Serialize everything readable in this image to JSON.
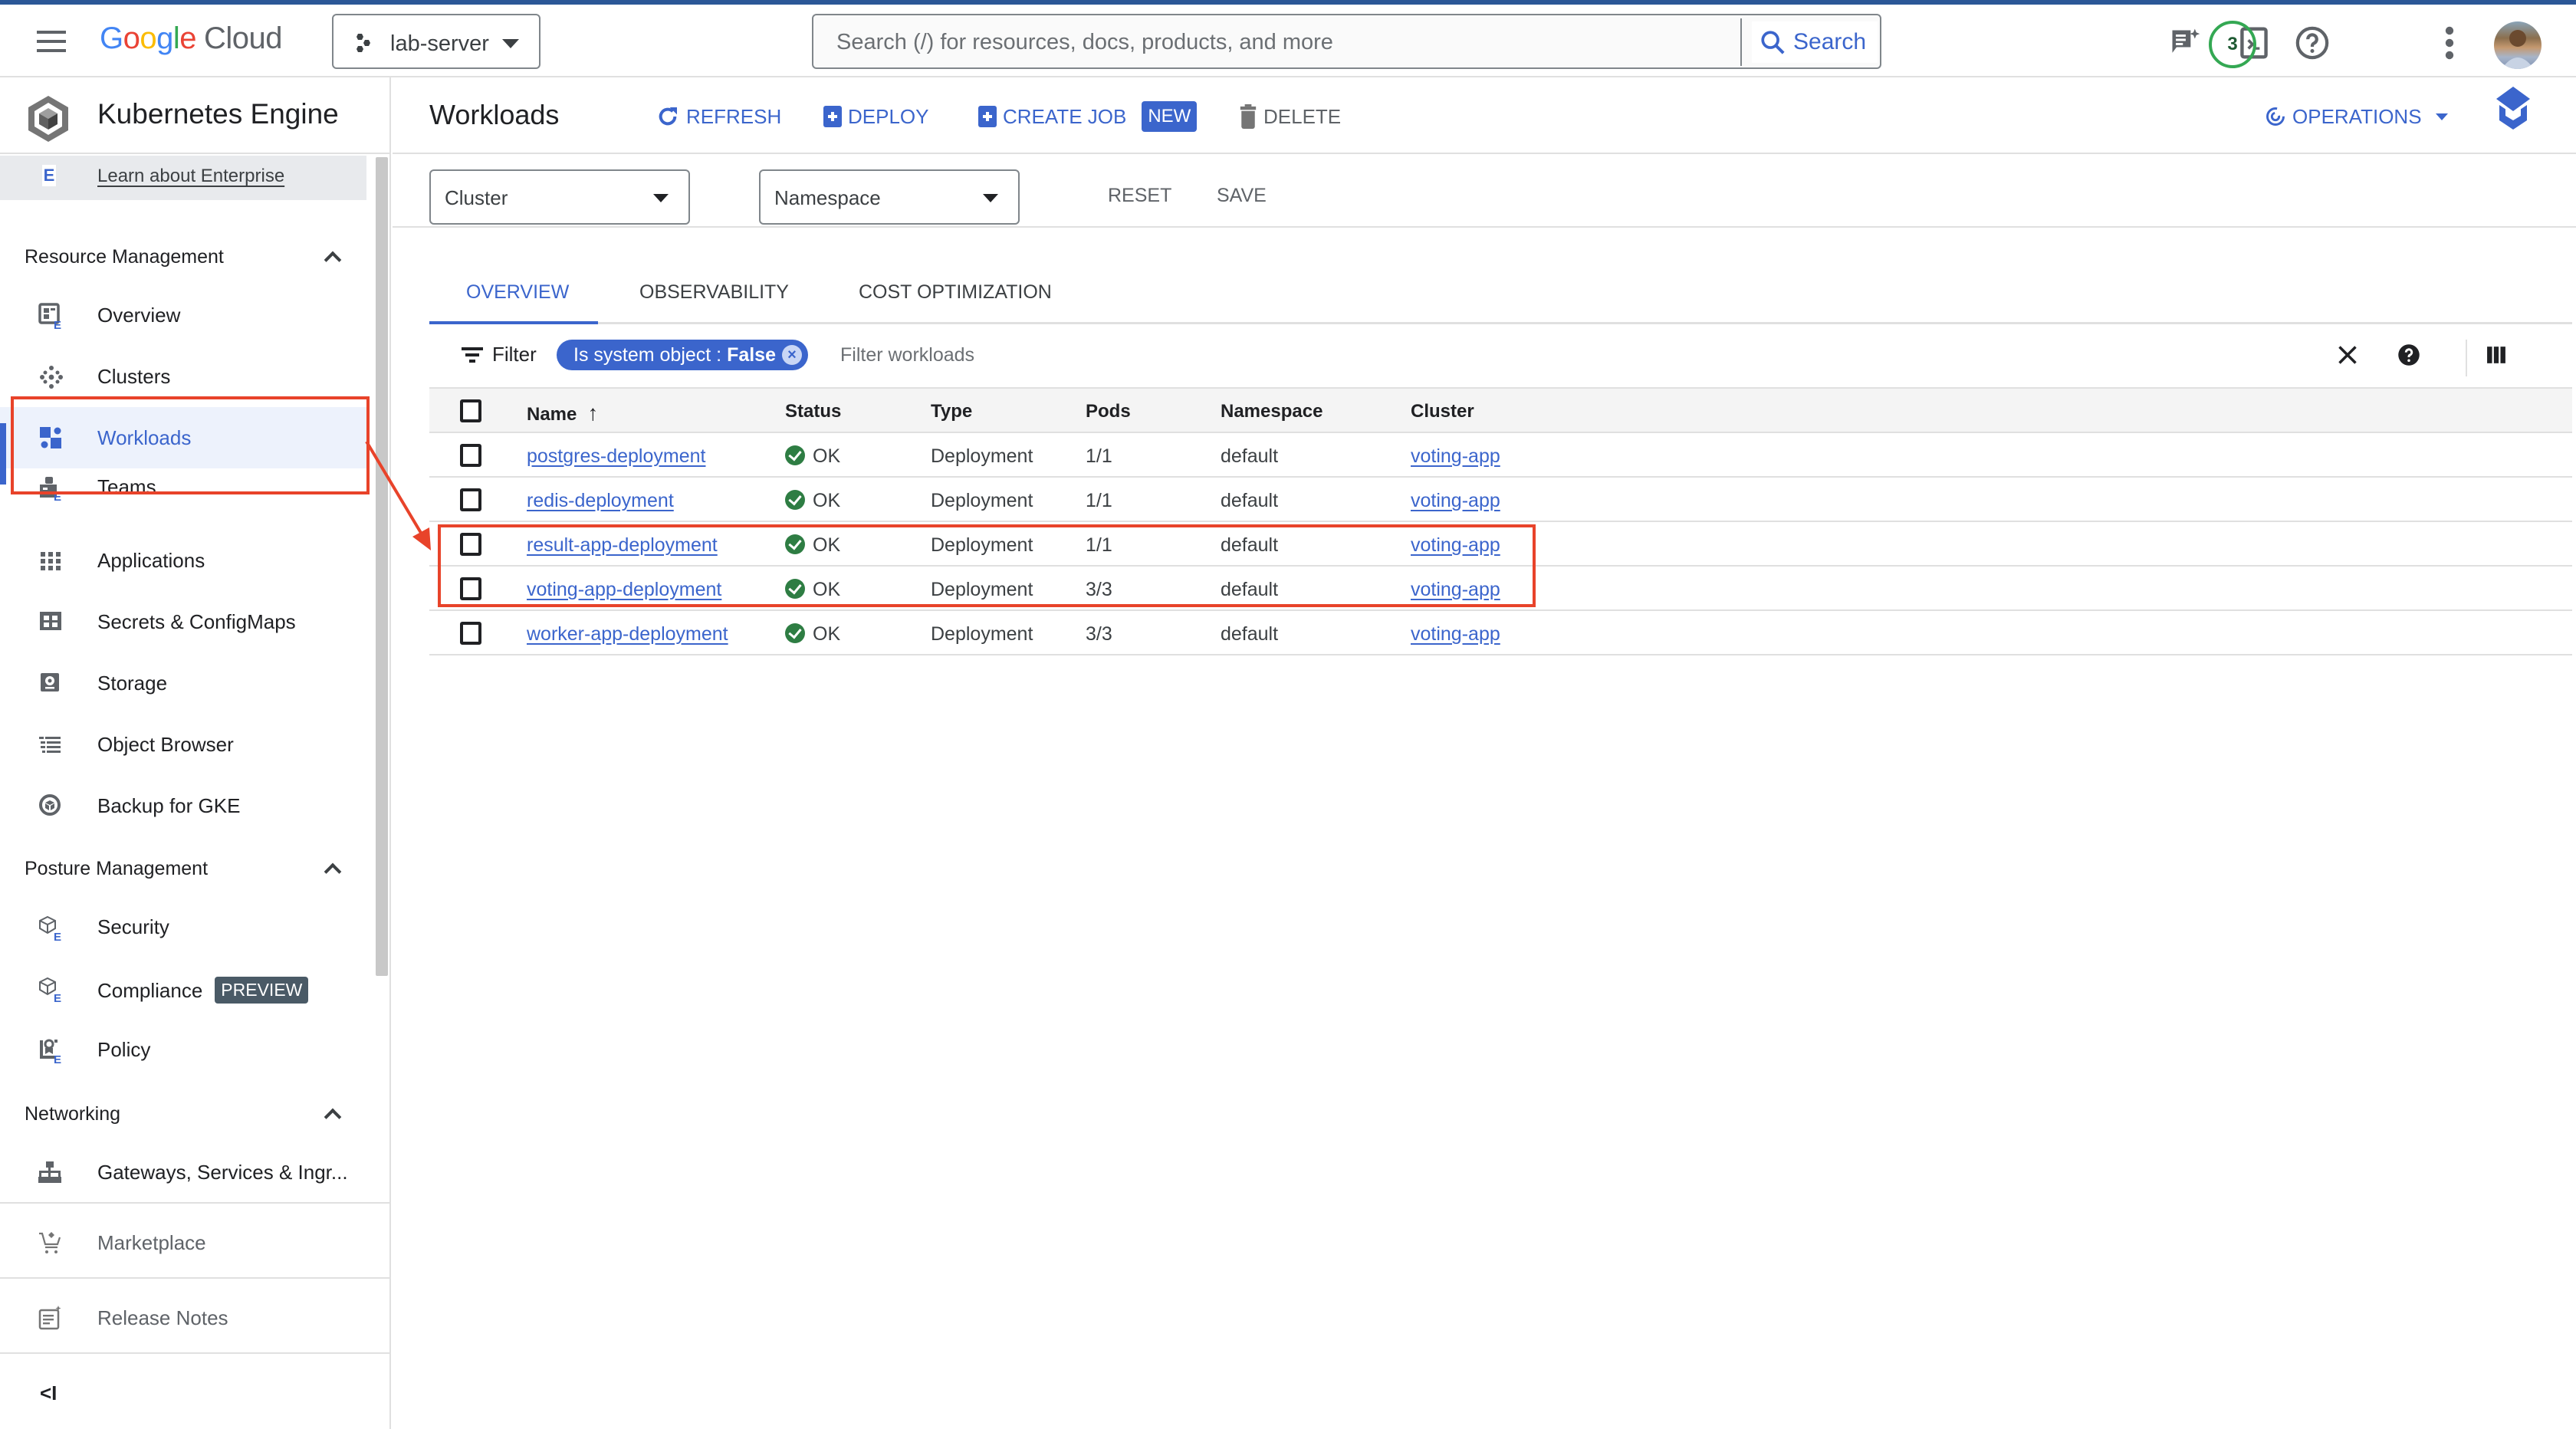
{
  "header": {
    "brand": {
      "google": [
        "G",
        "o",
        "o",
        "g",
        "l",
        "e"
      ],
      "product": "Cloud"
    },
    "project": {
      "name": "lab-server"
    },
    "search": {
      "placeholder": "Search (/) for resources, docs, products, and more",
      "button_label": "Search"
    },
    "icons": [
      "gemini-chat-icon",
      "cloud-shell-icon",
      "notifications-badge",
      "help-icon",
      "more-vert-icon",
      "avatar"
    ],
    "notifications_count": "3"
  },
  "sidebar": {
    "title": "Kubernetes Engine",
    "learn": {
      "badge": "E",
      "label": "Learn about Enterprise"
    },
    "sections": [
      {
        "label": "Resource Management",
        "expanded": true,
        "items": [
          {
            "label": "Overview",
            "icon": "overview-icon",
            "enterprise": true
          },
          {
            "label": "Clusters",
            "icon": "clusters-icon"
          },
          {
            "label": "Workloads",
            "icon": "workloads-icon",
            "active": true
          },
          {
            "label": "Teams",
            "icon": "teams-icon",
            "enterprise": true
          },
          {
            "label": "Applications",
            "icon": "applications-icon"
          },
          {
            "label": "Secrets & ConfigMaps",
            "icon": "secrets-icon"
          },
          {
            "label": "Storage",
            "icon": "storage-icon"
          },
          {
            "label": "Object Browser",
            "icon": "object-browser-icon"
          },
          {
            "label": "Backup for GKE",
            "icon": "backup-icon"
          }
        ]
      },
      {
        "label": "Posture Management",
        "expanded": true,
        "items": [
          {
            "label": "Security",
            "icon": "security-icon",
            "enterprise": true
          },
          {
            "label": "Compliance",
            "icon": "compliance-icon",
            "enterprise": true,
            "badge": "PREVIEW"
          },
          {
            "label": "Policy",
            "icon": "policy-icon",
            "enterprise": true
          }
        ]
      },
      {
        "label": "Networking",
        "expanded": true,
        "items": [
          {
            "label": "Gateways, Services & Ingr...",
            "icon": "gateways-icon"
          }
        ]
      }
    ],
    "footer": [
      {
        "label": "Marketplace",
        "icon": "marketplace-icon"
      },
      {
        "label": "Release Notes",
        "icon": "release-notes-icon"
      }
    ],
    "collapse_label": "<I"
  },
  "toolbar": {
    "title": "Workloads",
    "refresh": "REFRESH",
    "deploy": "DEPLOY",
    "create_job": "CREATE JOB",
    "new_badge": "NEW",
    "delete": "DELETE",
    "operations": "OPERATIONS"
  },
  "filters": {
    "cluster": "Cluster",
    "namespace": "Namespace",
    "reset": "RESET",
    "save": "SAVE"
  },
  "tabs": [
    {
      "label": "OVERVIEW",
      "active": true
    },
    {
      "label": "OBSERVABILITY"
    },
    {
      "label": "COST OPTIMIZATION"
    }
  ],
  "filterbar": {
    "label": "Filter",
    "chip_key": "Is system object : ",
    "chip_value": "False",
    "placeholder": "Filter workloads"
  },
  "table": {
    "columns": [
      "Name",
      "Status",
      "Type",
      "Pods",
      "Namespace",
      "Cluster"
    ],
    "sort": {
      "column": "Name",
      "direction": "ascending"
    },
    "rows": [
      {
        "name": "postgres-deployment",
        "status": "OK",
        "type": "Deployment",
        "pods": "1/1",
        "namespace": "default",
        "cluster": "voting-app"
      },
      {
        "name": "redis-deployment",
        "status": "OK",
        "type": "Deployment",
        "pods": "1/1",
        "namespace": "default",
        "cluster": "voting-app"
      },
      {
        "name": "result-app-deployment",
        "status": "OK",
        "type": "Deployment",
        "pods": "1/1",
        "namespace": "default",
        "cluster": "voting-app"
      },
      {
        "name": "voting-app-deployment",
        "status": "OK",
        "type": "Deployment",
        "pods": "3/3",
        "namespace": "default",
        "cluster": "voting-app"
      },
      {
        "name": "worker-app-deployment",
        "status": "OK",
        "type": "Deployment",
        "pods": "3/3",
        "namespace": "default",
        "cluster": "voting-app"
      }
    ]
  },
  "colors": {
    "accent": "#3b65cc",
    "ok": "#2e7d43",
    "annotation": "#e8432a",
    "top_bar": "#2b5797"
  }
}
